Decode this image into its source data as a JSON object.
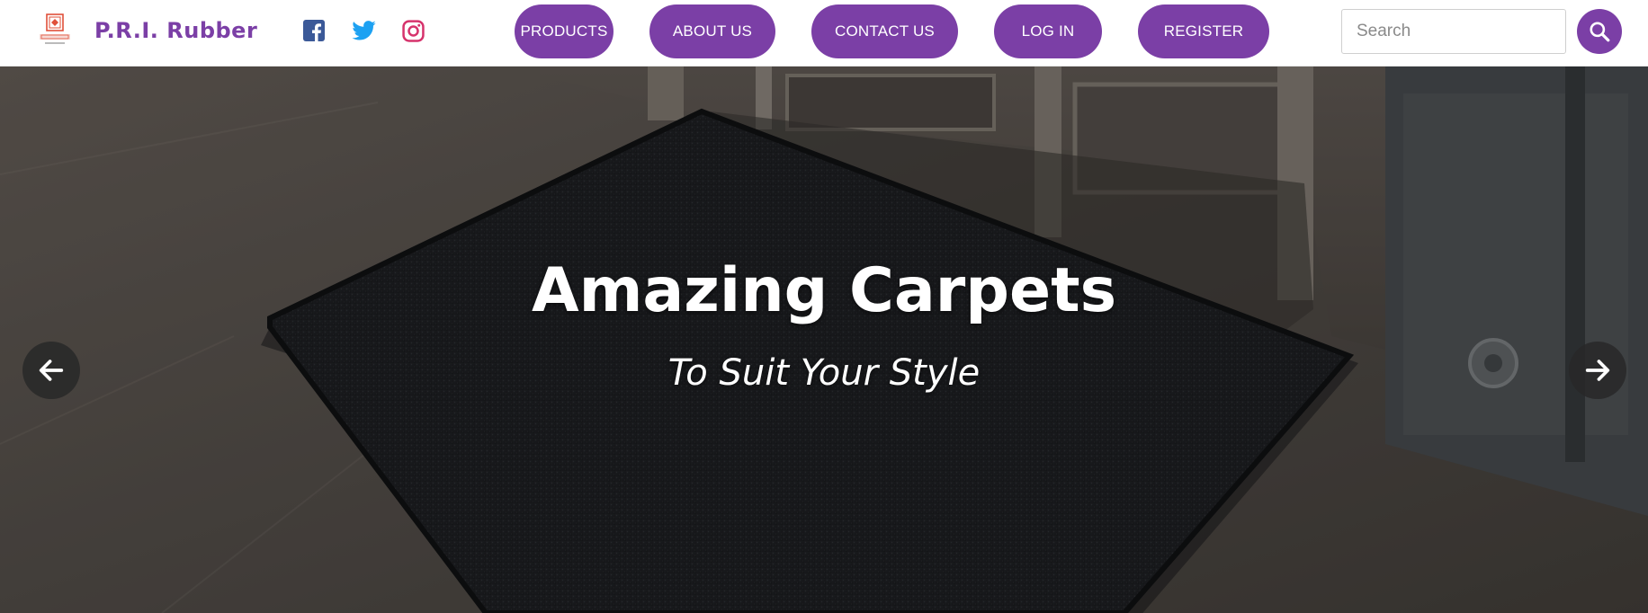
{
  "brand": {
    "name": "P.R.I. Rubber",
    "color": "#7b3fa6"
  },
  "colors": {
    "accent": "#7b3fa6",
    "facebook": "#3b5998",
    "twitter": "#1da1f2",
    "instagram": "#d6336c"
  },
  "social": [
    {
      "icon": "facebook-icon"
    },
    {
      "icon": "twitter-icon"
    },
    {
      "icon": "instagram-icon"
    }
  ],
  "nav": {
    "products": "PRODUCTS",
    "about": "ABOUT US",
    "contact": "CONTACT US",
    "login": "LOG IN",
    "register": "REGISTER"
  },
  "search": {
    "placeholder": "Search",
    "value": "",
    "icon": "search-icon"
  },
  "hero": {
    "title": "Amazing Carpets",
    "subtitle": "To Suit Your Style",
    "prev_icon": "arrow-left-icon",
    "next_icon": "arrow-right-icon"
  }
}
